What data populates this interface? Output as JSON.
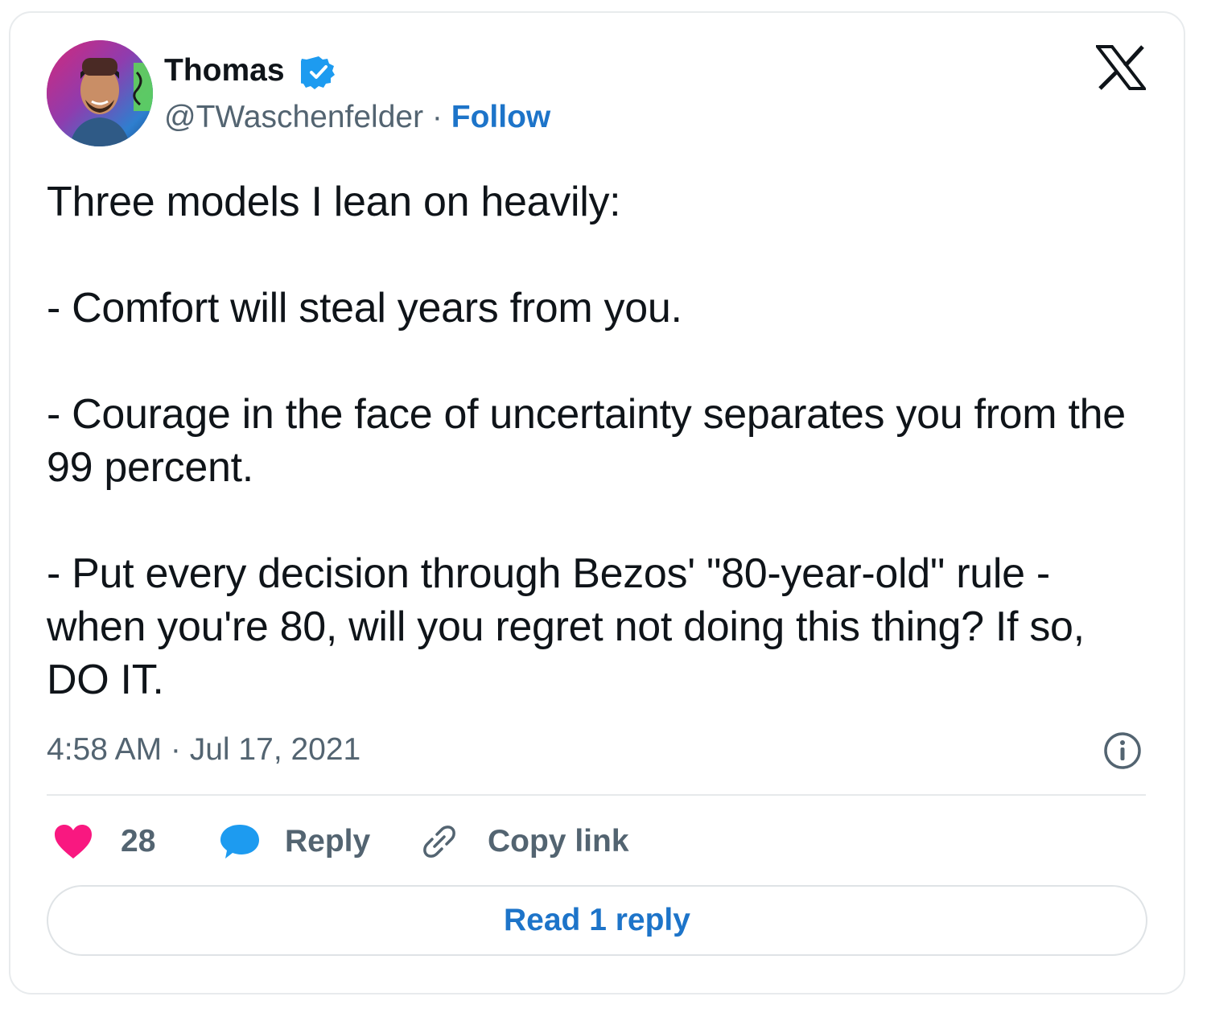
{
  "author": {
    "name": "Thomas",
    "handle": "@TWaschenfelder",
    "separator": " · ",
    "follow_label": "Follow",
    "verified": true
  },
  "tweet": {
    "text": "Three models I lean on heavily:\n\n- Comfort will steal years from you.\n\n- Courage in the face of uncertainty separates you from the 99 percent.\n\n- Put every decision through Bezos' \"80-year-old\" rule - when you're 80, will you regret not doing this thing? If so, DO IT.",
    "timestamp": "4:58 AM · Jul 17, 2021"
  },
  "actions": {
    "like_count": "28",
    "reply_label": "Reply",
    "copy_link_label": "Copy link"
  },
  "read_replies_label": "Read 1 reply",
  "icons": {
    "logo": "x-logo-icon",
    "verified": "verified-badge-icon",
    "info": "info-icon",
    "like": "heart-icon",
    "reply": "speech-bubble-icon",
    "copy": "link-icon"
  },
  "colors": {
    "link_blue": "#1d74c9",
    "heart_pink": "#f91880",
    "reply_blue": "#1d9bf0",
    "secondary_text": "#536471",
    "primary_text": "#0f1419",
    "verified_blue": "#1d9bf0"
  }
}
